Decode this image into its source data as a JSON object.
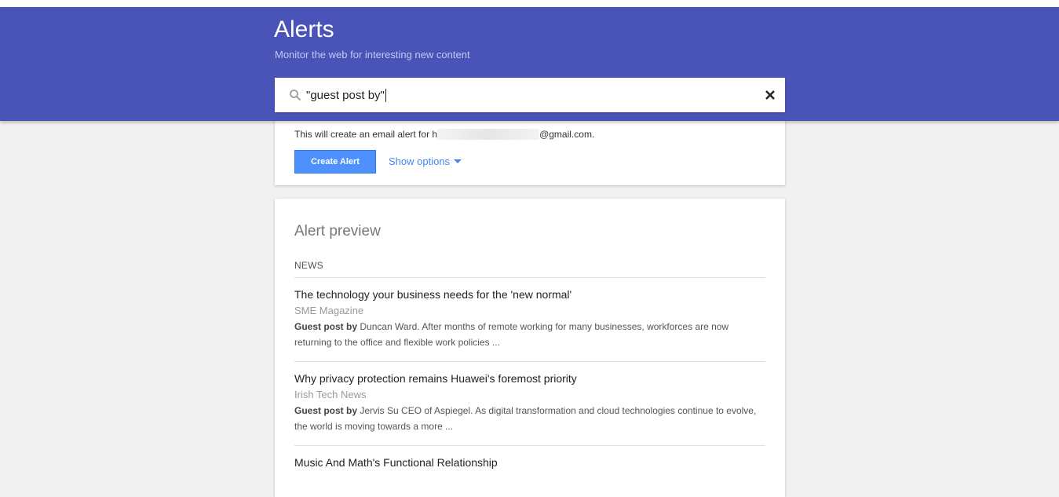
{
  "header": {
    "title": "Alerts",
    "subtitle": "Monitor the web for interesting new content"
  },
  "search": {
    "value": "\"guest post by\""
  },
  "create_card": {
    "email_prefix": "This will create an email alert for h",
    "email_suffix": "@gmail.com.",
    "create_label": "Create Alert",
    "options_label": "Show options"
  },
  "preview": {
    "title": "Alert preview",
    "section": "NEWS",
    "items": [
      {
        "title": "The technology your business needs for the 'new normal'",
        "source": "SME Magazine",
        "bold": "Guest post by",
        "snippet": " Duncan Ward. After months of remote working for many businesses, workforces are now returning to the office and flexible work policies ..."
      },
      {
        "title": "Why privacy protection remains Huawei's foremost priority",
        "source": "Irish Tech News",
        "bold": "Guest post by",
        "snippet": " Jervis Su CEO of Aspiegel. As digital transformation and cloud technologies continue to evolve, the world is moving towards a more ..."
      },
      {
        "title": "Music And Math's Functional Relationship",
        "source": "",
        "bold": "",
        "snippet": ""
      }
    ]
  },
  "colors": {
    "header_bg": "#4a53b8",
    "button_blue": "#4d90fe",
    "link_blue": "#4285f4"
  },
  "icons": [
    "search-icon",
    "close-icon",
    "caret-down-icon"
  ]
}
